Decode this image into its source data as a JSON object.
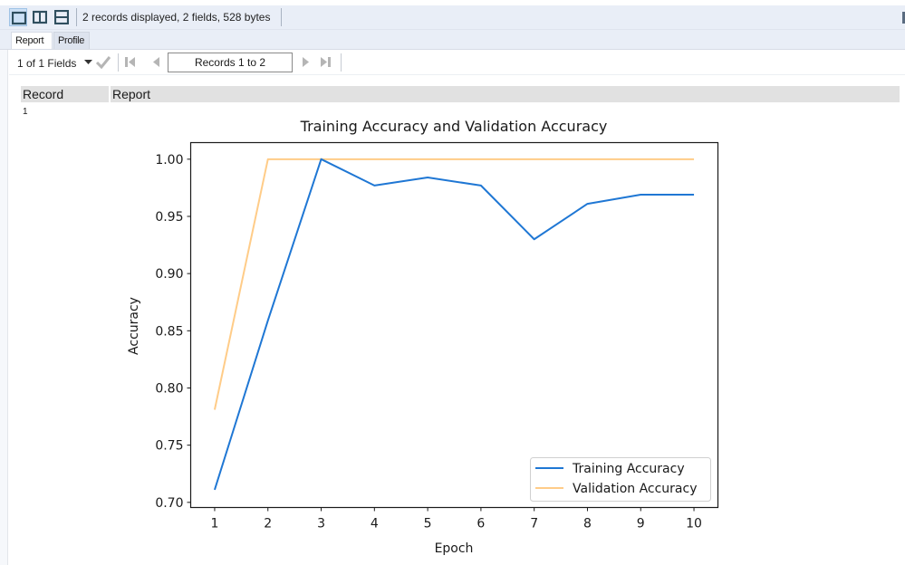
{
  "toolbar": {
    "view_buttons": [
      {
        "icon": "single-pane-icon",
        "active": true
      },
      {
        "icon": "vertical-split-icon",
        "active": false
      },
      {
        "icon": "horizontal-split-icon",
        "active": false
      }
    ],
    "status": "2 records displayed, 2 fields, 528 bytes"
  },
  "tabs": [
    {
      "label": "Report",
      "active": true
    },
    {
      "label": "Profile",
      "active": false
    }
  ],
  "navigation": {
    "fields_selector": "1 of 1 Fields",
    "records_range": "Records 1 to 2",
    "icons": [
      "dropdown-arrow-icon",
      "checkmark-icon",
      "first-record-icon",
      "previous-record-icon",
      "next-record-icon",
      "last-record-icon"
    ]
  },
  "table": {
    "columns": [
      "Record",
      "Report"
    ],
    "rows": [
      {
        "record": "1"
      }
    ]
  },
  "colors": {
    "training": "#1f77d4",
    "validation": "#ffcc88"
  },
  "chart_data": {
    "type": "line",
    "title": "Training Accuracy and Validation Accuracy",
    "xlabel": "Epoch",
    "ylabel": "Accuracy",
    "x": [
      1,
      2,
      3,
      4,
      5,
      6,
      7,
      8,
      9,
      10
    ],
    "xticks": [
      "1",
      "2",
      "3",
      "4",
      "5",
      "6",
      "7",
      "8",
      "9",
      "10"
    ],
    "yticks": [
      "0.70",
      "0.75",
      "0.80",
      "0.85",
      "0.90",
      "0.95",
      "1.00"
    ],
    "ytick_values": [
      0.7,
      0.75,
      0.8,
      0.85,
      0.9,
      0.95,
      1.0
    ],
    "xlim": [
      0.55,
      10.45
    ],
    "ylim": [
      0.6955,
      1.0145
    ],
    "grid": false,
    "legend_position": "lower-right",
    "series": [
      {
        "name": "Training Accuracy",
        "values": [
          0.711,
          0.859,
          1.0,
          0.977,
          0.984,
          0.977,
          0.93,
          0.961,
          0.969,
          0.969
        ]
      },
      {
        "name": "Validation Accuracy",
        "values": [
          0.781,
          1.0,
          1.0,
          1.0,
          1.0,
          1.0,
          1.0,
          1.0,
          1.0,
          1.0
        ]
      }
    ]
  }
}
